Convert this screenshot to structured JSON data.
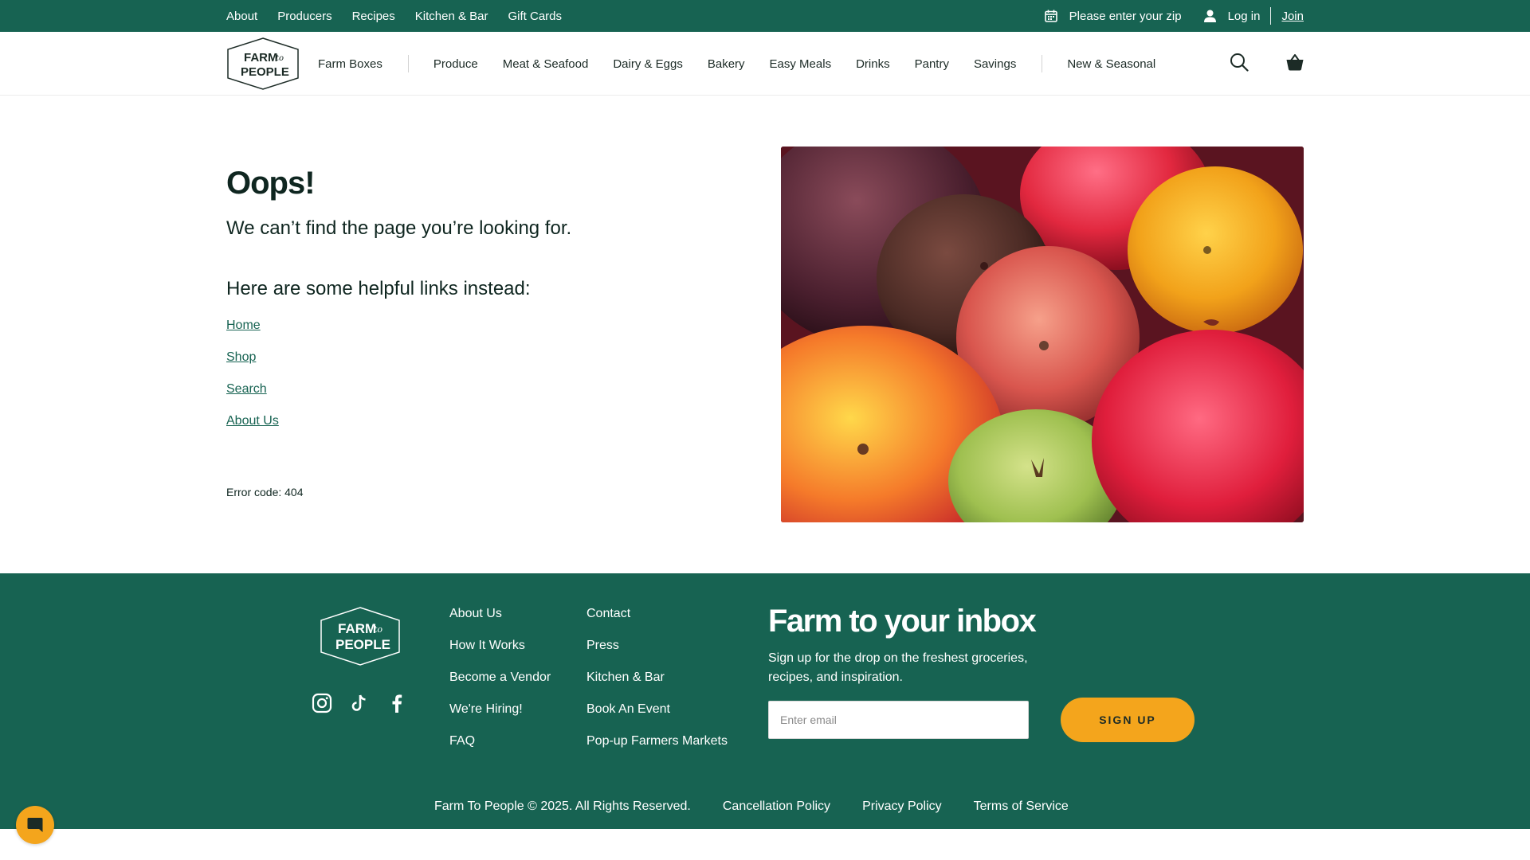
{
  "topbar": {
    "links": [
      "About",
      "Producers",
      "Recipes",
      "Kitchen & Bar",
      "Gift Cards"
    ],
    "zip_text": "Please enter your zip",
    "login": "Log in",
    "join": "Join"
  },
  "brand": {
    "logo_line1": "FARM",
    "logo_to": "to",
    "logo_line2": "PEOPLE",
    "primary_color": "#176352",
    "accent_color": "#f4a51c"
  },
  "nav": {
    "farm_boxes": "Farm Boxes",
    "categories": [
      "Produce",
      "Meat & Seafood",
      "Dairy & Eggs",
      "Bakery",
      "Easy Meals",
      "Drinks",
      "Pantry",
      "Savings"
    ],
    "new_seasonal": "New & Seasonal",
    "icons": [
      "search-icon",
      "cart-icon"
    ]
  },
  "error": {
    "title": "Oops!",
    "subtitle": "We can’t find the page you’re looking for.",
    "helpful_heading": "Here are some helpful links instead:",
    "links": [
      "Home",
      "Shop",
      "Search",
      "About Us"
    ],
    "code": "Error code: 404"
  },
  "footer": {
    "col1": [
      "About Us",
      "How It Works",
      "Become a Vendor",
      "We're Hiring!",
      "FAQ"
    ],
    "col2": [
      "Contact",
      "Press",
      "Kitchen & Bar",
      "Book An Event",
      "Pop-up Farmers Markets"
    ],
    "social": [
      "instagram-icon",
      "tiktok-icon",
      "facebook-icon"
    ],
    "newsletter_title": "Farm to your inbox",
    "newsletter_sub": "Sign up for the drop on the freshest groceries, recipes, and inspiration.",
    "email_placeholder": "Enter email",
    "signup_label": "SIGN UP",
    "copyright": "Farm To People © 2025. All Rights Reserved.",
    "legal_links": [
      "Cancellation Policy",
      "Privacy Policy",
      "Terms of Service"
    ]
  }
}
